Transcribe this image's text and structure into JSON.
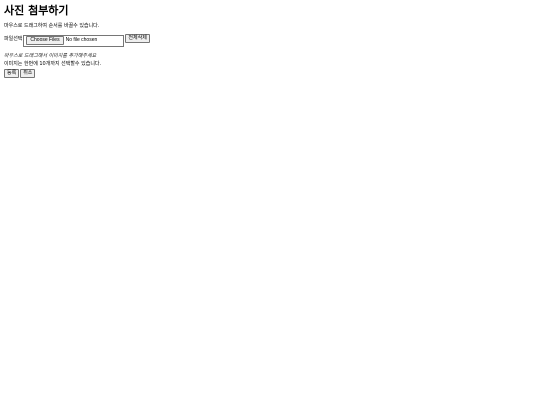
{
  "page": {
    "title": "사진 첨부하기",
    "reorder_hint": "마우스로 드래그하여 순서를 바꿀수 있습니다."
  },
  "file_picker": {
    "label": "파일선택",
    "choose_button": "Choose Files",
    "status": "No file chosen",
    "delete_all_button": "전체삭제"
  },
  "drop_zone": {
    "text": "마우스로 드래그해서 이미지를 추가해주세요"
  },
  "limit_note": "이미지는 한번에 10개까지 선택할수 있습니다.",
  "actions": {
    "submit_label": "등록",
    "cancel_label": "취소"
  }
}
